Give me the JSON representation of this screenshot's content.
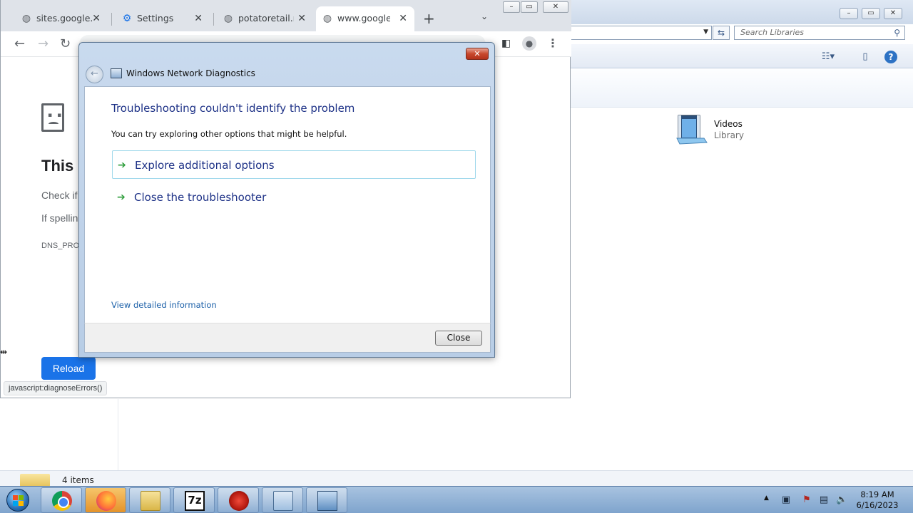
{
  "explorer": {
    "search_placeholder": "Search Libraries",
    "videos_name": "Videos",
    "videos_type": "Library",
    "status_items": "4 items"
  },
  "chrome": {
    "tabs": [
      {
        "title": "sites.google.co",
        "icon": "globe-icon"
      },
      {
        "title": "Settings",
        "icon": "gear-icon"
      },
      {
        "title": "potatoretail.ne",
        "icon": "globe-icon"
      },
      {
        "title": "www.google.c",
        "icon": "globe-icon"
      }
    ],
    "error_title_visible": "This s",
    "error_check_visible": "Check if",
    "error_spelling_visible": "If spellin",
    "error_code_visible": "DNS_PRO",
    "reload_label": "Reload",
    "status_url": "javascript:diagnoseErrors()"
  },
  "dialog": {
    "title": "Windows Network Diagnostics",
    "heading": "Troubleshooting couldn't identify the problem",
    "subtext": "You can try exploring other options that might be helpful.",
    "options": [
      {
        "label": "Explore additional options"
      },
      {
        "label": "Close the troubleshooter"
      }
    ],
    "details_link": "View detailed information",
    "close_button": "Close"
  },
  "taskbar": {
    "apps": [
      "Google Chrome",
      "Firefox",
      "Windows Explorer",
      "7-Zip",
      "Red app",
      "Control Panel",
      "Network Diagnostics"
    ],
    "seven_zip_label": "7z",
    "time": "8:19 AM",
    "date": "6/16/2023"
  },
  "colors": {
    "reload_blue": "#1a73e8",
    "dialog_heading": "#1e3287",
    "link_blue": "#1a5fa8",
    "option_arrow": "#2f9e3c"
  }
}
